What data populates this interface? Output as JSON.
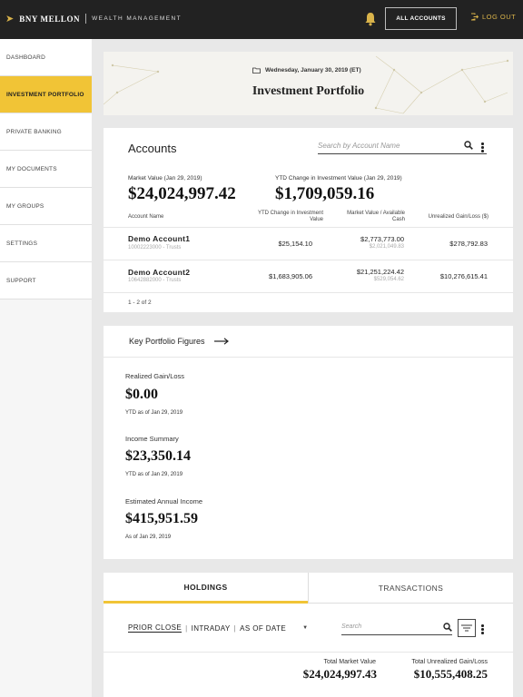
{
  "header": {
    "brand": "BNY MELLON",
    "subbrand": "WEALTH MANAGEMENT",
    "all_accounts": "ALL ACCOUNTS",
    "logout": "LOG OUT",
    "accent": "#d9b34a"
  },
  "sidebar": {
    "items": [
      {
        "label": "DASHBOARD"
      },
      {
        "label": "INVESTMENT PORTFOLIO",
        "active": true
      },
      {
        "label": "PRIVATE BANKING"
      },
      {
        "label": "MY DOCUMENTS"
      },
      {
        "label": "MY GROUPS"
      },
      {
        "label": "SETTINGS"
      },
      {
        "label": "SUPPORT"
      }
    ],
    "active_color": "#f1c436"
  },
  "hero": {
    "date": "Wednesday, January 30, 2019 (ET)",
    "title": "Investment Portfolio"
  },
  "accounts": {
    "title": "Accounts",
    "search_placeholder": "Search by Account Name",
    "market_value_label": "Market Value (Jan 29, 2019)",
    "market_value": "$24,024,997.42",
    "ytd_label": "YTD Change in Investment Value (Jan 29, 2019)",
    "ytd_value": "$1,709,059.16",
    "columns": {
      "name": "Account Name",
      "ytd_line1": "YTD Change in Investment",
      "ytd_line2": "Value",
      "mv_line1": "Market Value / Available",
      "mv_line2": "Cash",
      "gain": "Unrealized Gain/Loss ($)"
    },
    "rows": [
      {
        "name": "Demo Account1",
        "sub": "10002223000 - Trusts",
        "ytd": "$25,154.10",
        "mv": "$2,773,773.00",
        "cash": "$2,021,049.83",
        "gain": "$278,792.83"
      },
      {
        "name": "Demo Account2",
        "sub": "10642882000 - Trusts",
        "ytd": "$1,683,905.06",
        "mv": "$21,251,224.42",
        "cash": "$529,054.62",
        "gain": "$10,276,615.41"
      }
    ],
    "pager": "1 - 2 of 2"
  },
  "key_figures": {
    "title": "Key Portfolio Figures",
    "items": [
      {
        "label": "Realized Gain/Loss",
        "value": "$0.00",
        "sub": "YTD as of Jan 29, 2019"
      },
      {
        "label": "Income Summary",
        "value": "$23,350.14",
        "sub": "YTD as of Jan 29, 2019"
      },
      {
        "label": "Estimated Annual Income",
        "value": "$415,951.59",
        "sub": "As of Jan 29, 2019"
      }
    ]
  },
  "holdings": {
    "tabs": [
      "HOLDINGS",
      "TRANSACTIONS"
    ],
    "filter_prior": "PRIOR CLOSE",
    "filter_intraday": "INTRADAY",
    "filter_asof": "AS OF DATE",
    "search_placeholder": "Search",
    "total_mv_label": "Total Market Value",
    "total_mv": "$24,024,997.43",
    "total_gain_label": "Total Unrealized Gain/Loss",
    "total_gain": "$10,555,408.25"
  }
}
